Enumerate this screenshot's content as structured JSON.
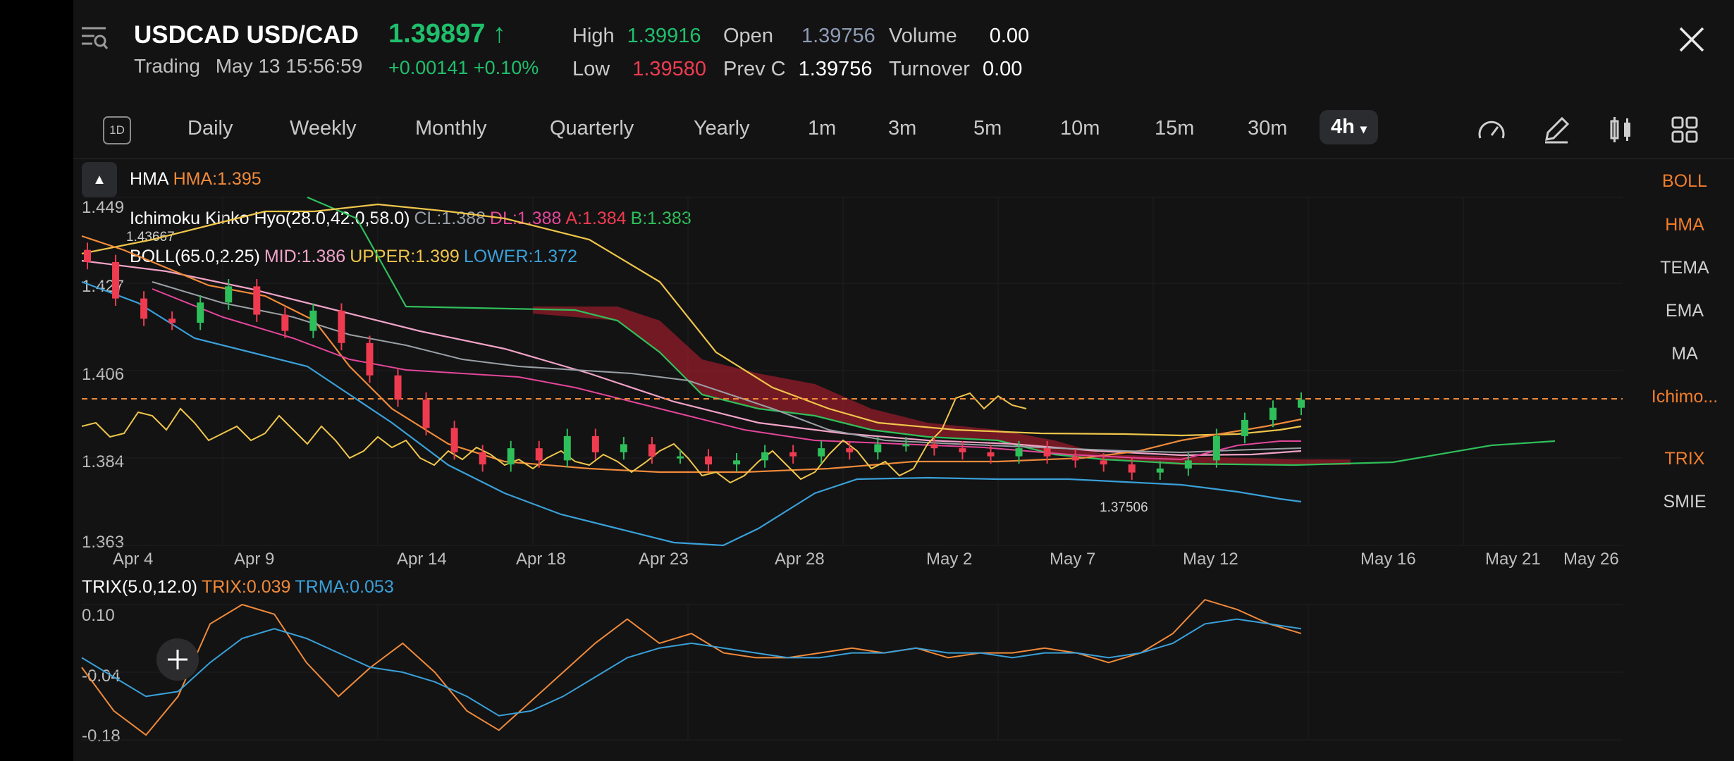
{
  "header": {
    "symbol": "USDCAD",
    "pair": "USD/CAD",
    "price": "1.39897",
    "price_arrow": "↑",
    "status": "Trading",
    "timestamp": "May 13 15:56:59",
    "change_abs": "+0.00141",
    "change_pct": "+0.10%",
    "stats": {
      "high_label": "High",
      "high": "1.39916",
      "low_label": "Low",
      "low": "1.39580",
      "open_label": "Open",
      "open": "1.39756",
      "prevc_label": "Prev C",
      "prevc": "1.39756",
      "volume_label": "Volume",
      "volume": "0.00",
      "turnover_label": "Turnover",
      "turnover": "0.00"
    }
  },
  "periods": {
    "daily": "Daily",
    "weekly": "Weekly",
    "monthly": "Monthly",
    "quarterly": "Quarterly",
    "yearly": "Yearly",
    "m1": "1m",
    "m3": "3m",
    "m5": "5m",
    "m10": "10m",
    "m15": "15m",
    "m30": "30m",
    "h4": "4h",
    "pd_icon": "1D"
  },
  "indicators": {
    "hma_name": "HMA",
    "hma_value": "HMA:1.395",
    "ichimoku_name": "Ichimoku Kinko Hyo(28.0,42.0,58.0)",
    "ichimoku_cl": "CL:1.388",
    "ichimoku_dl": "DL:1.388",
    "ichimoku_a": "A:1.384",
    "ichimoku_b": "B:1.383",
    "boll_name": "BOLL(65.0,2.25)",
    "boll_mid": "MID:1.386",
    "boll_upper": "UPPER:1.399",
    "boll_lower": "LOWER:1.372",
    "trix_name": "TRIX(5.0,12.0)",
    "trix_value": "TRIX:0.039",
    "trma_value": "TRMA:0.053"
  },
  "right_list": {
    "boll": "BOLL",
    "hma": "HMA",
    "tema": "TEMA",
    "ema": "EMA",
    "ma": "MA",
    "ichimoku": "Ichimo...",
    "trix": "TRIX",
    "smie": "SMIE"
  },
  "chart_data": [
    {
      "type": "candlestick",
      "title": "USDCAD 4h",
      "y_ticks": [
        "1.449",
        "1.427",
        "1.406",
        "1.384",
        "1.363"
      ],
      "ylim": [
        1.363,
        1.449
      ],
      "x_ticks": [
        "Apr 4",
        "Apr 9",
        "Apr 14",
        "Apr 18",
        "Apr 23",
        "Apr 28",
        "May 2",
        "May 7",
        "May 12",
        "May 16",
        "May 21",
        "May 26"
      ],
      "annotations": {
        "max": "1.43667",
        "min": "1.37506"
      },
      "last_price_line": 1.39897,
      "close_series": [
        1.433,
        1.424,
        1.419,
        1.418,
        1.423,
        1.427,
        1.42,
        1.416,
        1.421,
        1.413,
        1.405,
        1.399,
        1.392,
        1.386,
        1.383,
        1.387,
        1.384,
        1.39,
        1.386,
        1.388,
        1.385,
        1.385,
        1.383,
        1.384,
        1.386,
        1.385,
        1.387,
        1.386,
        1.388,
        1.388,
        1.387,
        1.386,
        1.385,
        1.387,
        1.385,
        1.384,
        1.383,
        1.381,
        1.382,
        1.384,
        1.39,
        1.394,
        1.397,
        1.399
      ]
    },
    {
      "type": "line",
      "title": "TRIX(5.0,12.0)",
      "y_ticks": [
        "0.10",
        "-0.04",
        "-0.18"
      ],
      "ylim": [
        -0.18,
        0.1
      ],
      "series": [
        {
          "name": "TRIX",
          "color": "#f08a3a",
          "values": [
            -0.03,
            -0.12,
            -0.17,
            -0.09,
            0.06,
            0.1,
            0.08,
            -0.02,
            -0.09,
            -0.03,
            0.02,
            -0.04,
            -0.12,
            -0.16,
            -0.1,
            -0.04,
            0.02,
            0.07,
            0.02,
            0.04,
            0.0,
            -0.01,
            -0.01,
            0.0,
            0.01,
            0.0,
            0.01,
            -0.01,
            0.0,
            0.0,
            0.01,
            0.0,
            -0.02,
            0.0,
            0.04,
            0.11,
            0.09,
            0.06,
            0.04
          ]
        },
        {
          "name": "TRMA",
          "color": "#3aa0d8",
          "values": [
            -0.01,
            -0.05,
            -0.09,
            -0.08,
            -0.02,
            0.03,
            0.05,
            0.03,
            0.0,
            -0.03,
            -0.04,
            -0.06,
            -0.09,
            -0.13,
            -0.12,
            -0.09,
            -0.05,
            -0.01,
            0.01,
            0.02,
            0.01,
            0.0,
            -0.01,
            -0.01,
            0.0,
            0.0,
            0.01,
            0.0,
            0.0,
            -0.01,
            0.0,
            0.0,
            -0.01,
            0.0,
            0.02,
            0.06,
            0.07,
            0.06,
            0.05
          ]
        }
      ]
    }
  ]
}
